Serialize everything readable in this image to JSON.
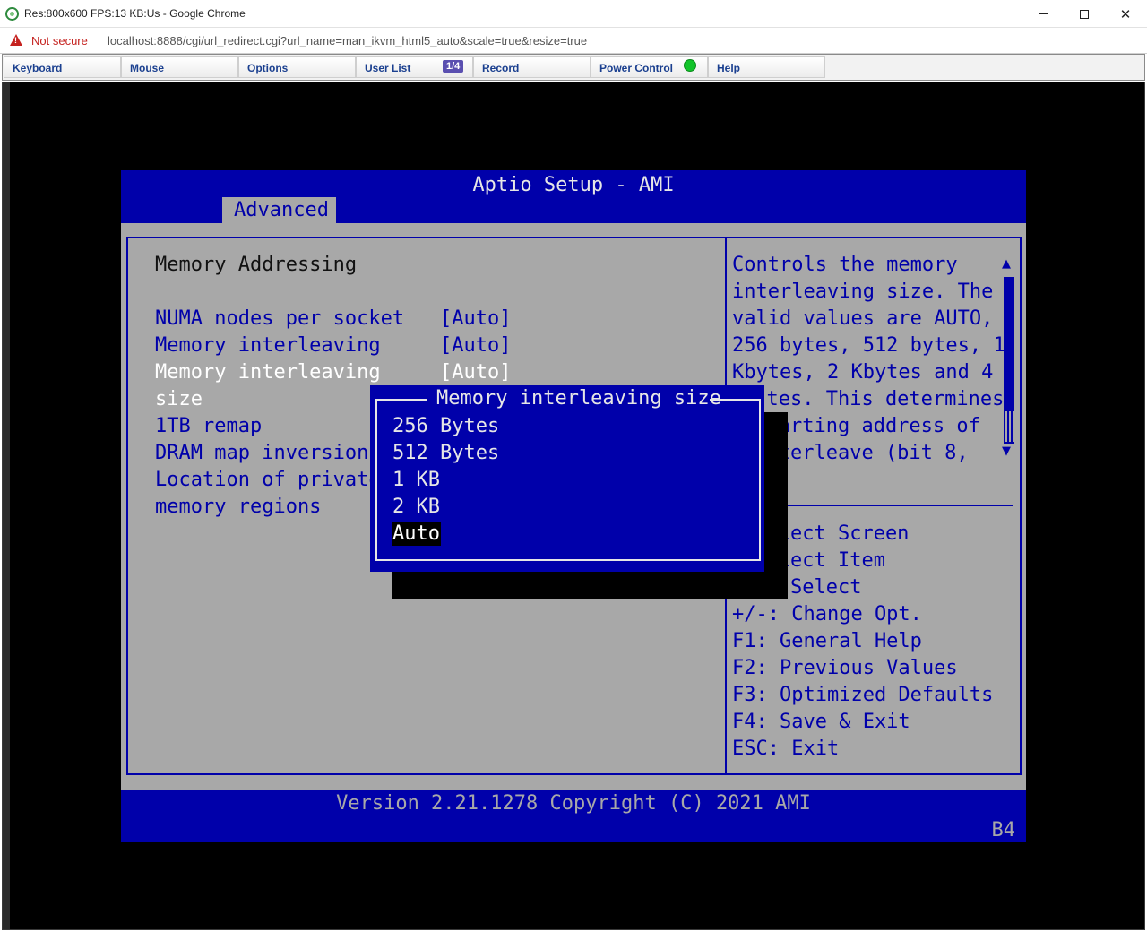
{
  "window": {
    "title": "Res:800x600 FPS:13 KB:Us - Google Chrome",
    "minimize_label": "",
    "maximize_label": "",
    "close_label": "✕"
  },
  "address_bar": {
    "security_label": "Not secure",
    "url": "localhost:8888/cgi/url_redirect.cgi?url_name=man_ikvm_html5_auto&scale=true&resize=true"
  },
  "kvm_toolbar": {
    "items": [
      "Keyboard",
      "Mouse",
      "Options",
      "User List",
      "Record",
      "Power Control",
      "Help"
    ],
    "user_count_badge": "1/4",
    "power_status_color": "#12c42a"
  },
  "bios": {
    "title": "Aptio Setup - AMI",
    "active_tab": "Advanced",
    "section_heading": "Memory Addressing",
    "settings": [
      {
        "label": "NUMA nodes per socket",
        "value": "[Auto]"
      },
      {
        "label": "Memory interleaving",
        "value": "[Auto]"
      },
      {
        "label_line1": "Memory interleaving",
        "label_line2": "size",
        "value": "[Auto]"
      },
      {
        "label": "1TB remap"
      },
      {
        "label": "DRAM map inversion"
      },
      {
        "label_line1": "Location of private",
        "label_line2": "memory regions"
      }
    ],
    "help_text": [
      "Controls the memory",
      "interleaving size. The",
      "valid values are AUTO,",
      "256 bytes, 512 bytes, 1",
      "Kbytes, 2 Kbytes and 4",
      "  tes. This determines",
      "  tarting address of",
      "  nterleave (bit 8,"
    ],
    "key_help": [
      "  elect Screen",
      "  elect Item",
      "  : Select",
      "+/-: Change Opt.",
      "F1: General Help",
      "F2: Previous Values",
      "F3: Optimized Defaults",
      "F4: Save & Exit",
      "ESC: Exit"
    ],
    "popup": {
      "title": "Memory interleaving size",
      "options": [
        "256 Bytes",
        "512 Bytes",
        "1 KB",
        "2 KB",
        "Auto"
      ],
      "selected": "Auto"
    },
    "footer_version": "Version 2.21.1278 Copyright (C) 2021 AMI",
    "footer_code": "B4",
    "colors": {
      "bios_blue": "#0000aa",
      "bios_gray": "#a8a8a8",
      "highlight_white": "#ffffff"
    }
  }
}
